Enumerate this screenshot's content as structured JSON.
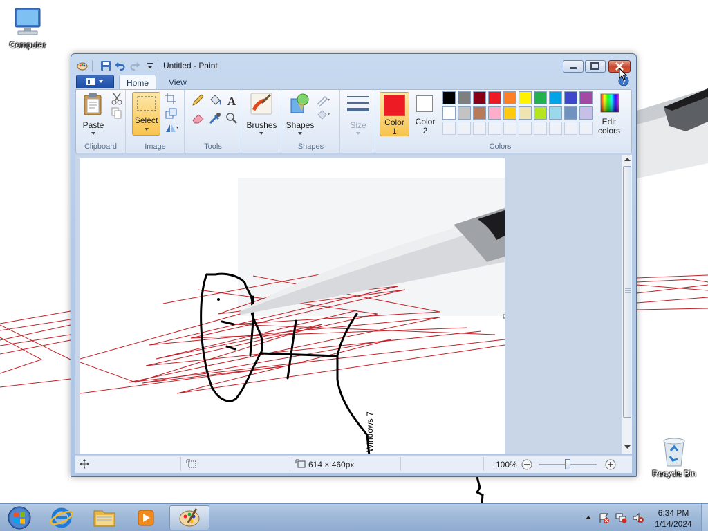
{
  "desktop": {
    "icons": [
      {
        "label": "Computer"
      },
      {
        "label": "Recycle Bin"
      }
    ],
    "canvas_text": "Windows 7"
  },
  "window": {
    "title": "Untitled - Paint",
    "tabs": [
      {
        "label": "Home",
        "active": true
      },
      {
        "label": "View",
        "active": false
      }
    ]
  },
  "ribbon": {
    "groups": {
      "clipboard": "Clipboard",
      "image": "Image",
      "tools": "Tools",
      "shapes": "Shapes",
      "colors": "Colors"
    },
    "buttons": {
      "paste": "Paste",
      "select": "Select",
      "brushes": "Brushes",
      "shapes": "Shapes",
      "size": "Size",
      "color1_line1": "Color",
      "color1_line2": "1",
      "color2_line1": "Color",
      "color2_line2": "2",
      "edit_colors_line1": "Edit",
      "edit_colors_line2": "colors"
    },
    "color1": "#ed1c24",
    "color2": "#ffffff",
    "palette_row1": [
      "#000000",
      "#7f7f7f",
      "#880015",
      "#ed1c24",
      "#ff7f27",
      "#fff200",
      "#22b14c",
      "#00a2e8",
      "#3f48cc",
      "#a349a4"
    ],
    "palette_row2": [
      "#ffffff",
      "#c3c3c3",
      "#b97a57",
      "#ffaec9",
      "#ffc90e",
      "#efe4b0",
      "#b5e61d",
      "#99d9ea",
      "#7092be",
      "#c8bfe7"
    ]
  },
  "statusbar": {
    "image_size": "614 × 460px",
    "zoom": "100%"
  },
  "taskbar": {
    "time": "6:34 PM",
    "date": "1/14/2024"
  }
}
